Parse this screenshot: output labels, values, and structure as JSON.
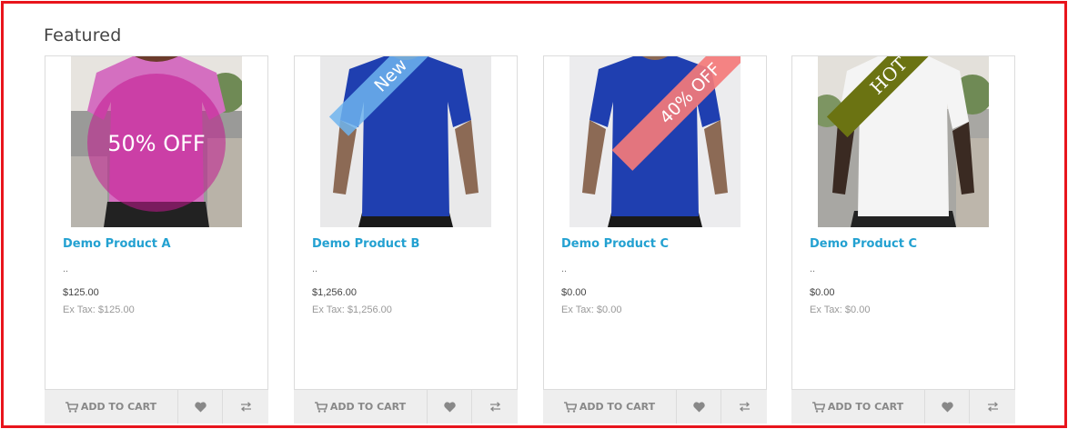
{
  "section": {
    "title": "Featured"
  },
  "products": [
    {
      "name": "Demo Product A",
      "description": "..",
      "price": "$125.00",
      "tax": "Ex Tax: $125.00",
      "badge": "50% OFF",
      "badge_color": "#c2188f",
      "shirt_color": "#d46fc0",
      "add_to_cart_label": "ADD TO CART",
      "icons": [
        "cart-icon",
        "heart-icon",
        "compare-icon"
      ]
    },
    {
      "name": "Demo Product B",
      "description": "..",
      "price": "$1,256.00",
      "tax": "Ex Tax: $1,256.00",
      "badge": "New",
      "badge_color": "#6fb4ee",
      "shirt_color": "#1f3fb0",
      "add_to_cart_label": "ADD TO CART",
      "icons": [
        "cart-icon",
        "heart-icon",
        "compare-icon"
      ]
    },
    {
      "name": "Demo Product C",
      "description": "..",
      "price": "$0.00",
      "tax": "Ex Tax: $0.00",
      "badge": "40% OFF",
      "badge_color": "#f47a7a",
      "shirt_color": "#1f3fb0",
      "add_to_cart_label": "ADD TO CART",
      "icons": [
        "cart-icon",
        "heart-icon",
        "compare-icon"
      ]
    },
    {
      "name": "Demo Product C",
      "description": "..",
      "price": "$0.00",
      "tax": "Ex Tax: $0.00",
      "badge": "HOT",
      "badge_color": "#6b7312",
      "shirt_color": "#f4f4f4",
      "add_to_cart_label": "ADD TO CART",
      "icons": [
        "cart-icon",
        "heart-icon",
        "compare-icon"
      ]
    }
  ],
  "colors": {
    "frame_border": "#e8141c",
    "link": "#23a1d1",
    "button_bg": "#eeeeee"
  }
}
